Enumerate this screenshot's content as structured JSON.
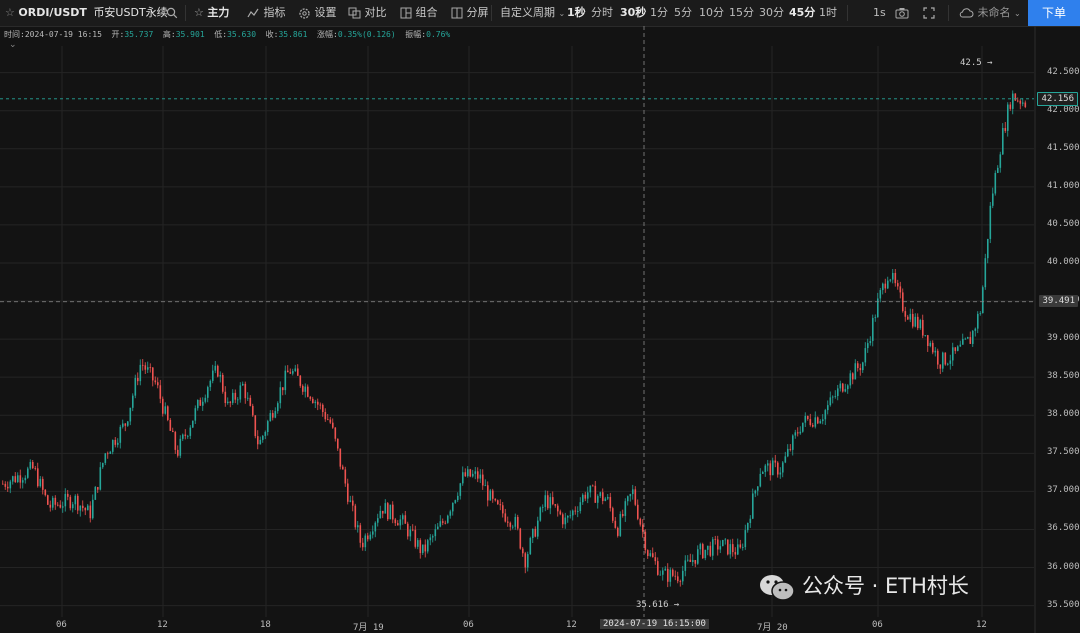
{
  "toolbar": {
    "symbol": "ORDI/USDT",
    "exchange": "币安USDT永续",
    "buttons": [
      {
        "label": "主力",
        "icon": "star-icon"
      },
      {
        "label": "指标",
        "icon": "indicator-icon"
      },
      {
        "label": "设置",
        "icon": "gear-icon"
      },
      {
        "label": "对比",
        "icon": "compare-icon"
      },
      {
        "label": "组合",
        "icon": "combo-icon"
      },
      {
        "label": "分屏",
        "icon": "split-screen-icon"
      }
    ],
    "custom_period": "自定义周期",
    "intervals": [
      {
        "label": "1秒",
        "active": true
      },
      {
        "label": "分时",
        "active": false
      },
      {
        "label": "30秒",
        "active": true
      },
      {
        "label": "1分",
        "active": false
      },
      {
        "label": "5分",
        "active": false
      },
      {
        "label": "10分",
        "active": false
      },
      {
        "label": "15分",
        "active": false
      },
      {
        "label": "30分",
        "active": false
      },
      {
        "label": "45分",
        "active": true
      },
      {
        "label": "1时",
        "active": false
      }
    ],
    "refresh": "1s",
    "layout_name": "未命名",
    "order_button": "下单"
  },
  "ohlc": {
    "time_label": "时间:",
    "time": "2024-07-19 16:15",
    "open_label": "开:",
    "open": "35.737",
    "high_label": "高:",
    "high": "35.901",
    "low_label": "低:",
    "low": "35.630",
    "close_label": "收:",
    "close": "35.861",
    "change_label": "涨幅:",
    "change": "0.35%(0.126)",
    "amplitude_label": "振幅:",
    "amplitude": "0.76%"
  },
  "chart_data": {
    "type": "candlestick",
    "y_ticks": [
      "42.500",
      "42.000",
      "41.500",
      "41.000",
      "40.500",
      "40.000",
      "39.500",
      "39.000",
      "38.500",
      "38.000",
      "37.500",
      "37.000",
      "36.500",
      "36.000",
      "35.500"
    ],
    "x_ticks": [
      "06",
      "12",
      "18",
      "7月 19",
      "06",
      "12",
      "7月 20",
      "06",
      "12"
    ],
    "ylim": [
      35.35,
      42.85
    ],
    "last_price": "42.156",
    "crosshair_price": "39.491",
    "crosshair_time": "2024-07-19 16:15:00",
    "high_marker": "42.5",
    "low_marker": "35.616",
    "up_color": "#26a69a",
    "down_color": "#ef5350",
    "close_path": [
      [
        0,
        37.1
      ],
      [
        0.03,
        37.3
      ],
      [
        0.045,
        36.8
      ],
      [
        0.07,
        36.9
      ],
      [
        0.085,
        36.7
      ],
      [
        0.1,
        37.5
      ],
      [
        0.12,
        37.9
      ],
      [
        0.135,
        38.7
      ],
      [
        0.15,
        38.4
      ],
      [
        0.17,
        37.5
      ],
      [
        0.2,
        38.4
      ],
      [
        0.21,
        38.6
      ],
      [
        0.22,
        38.1
      ],
      [
        0.235,
        38.4
      ],
      [
        0.25,
        37.6
      ],
      [
        0.27,
        38.3
      ],
      [
        0.28,
        38.6
      ],
      [
        0.3,
        38.3
      ],
      [
        0.32,
        37.9
      ],
      [
        0.34,
        36.8
      ],
      [
        0.35,
        36.3
      ],
      [
        0.37,
        36.8
      ],
      [
        0.39,
        36.6
      ],
      [
        0.41,
        36.2
      ],
      [
        0.43,
        36.6
      ],
      [
        0.45,
        37.2
      ],
      [
        0.465,
        37.2
      ],
      [
        0.48,
        36.8
      ],
      [
        0.5,
        36.6
      ],
      [
        0.51,
        36.1
      ],
      [
        0.53,
        36.9
      ],
      [
        0.55,
        36.6
      ],
      [
        0.57,
        37.0
      ],
      [
        0.59,
        36.9
      ],
      [
        0.6,
        36.5
      ],
      [
        0.615,
        37.0
      ],
      [
        0.63,
        36.2
      ],
      [
        0.645,
        35.9
      ],
      [
        0.66,
        35.9
      ],
      [
        0.68,
        36.2
      ],
      [
        0.7,
        36.3
      ],
      [
        0.72,
        36.2
      ],
      [
        0.74,
        37.3
      ],
      [
        0.76,
        37.3
      ],
      [
        0.78,
        37.9
      ],
      [
        0.8,
        38.0
      ],
      [
        0.82,
        38.4
      ],
      [
        0.84,
        38.7
      ],
      [
        0.855,
        39.5
      ],
      [
        0.865,
        39.9
      ],
      [
        0.88,
        39.4
      ],
      [
        0.9,
        39.1
      ],
      [
        0.915,
        38.7
      ],
      [
        0.93,
        38.8
      ],
      [
        0.945,
        39.0
      ],
      [
        0.955,
        39.4
      ],
      [
        0.965,
        40.8
      ],
      [
        0.975,
        41.6
      ],
      [
        0.985,
        42.2
      ],
      [
        1.0,
        42.1
      ]
    ]
  },
  "watermark": {
    "text": "公众号 · ETH村长",
    "icon": "wechat-icon"
  }
}
